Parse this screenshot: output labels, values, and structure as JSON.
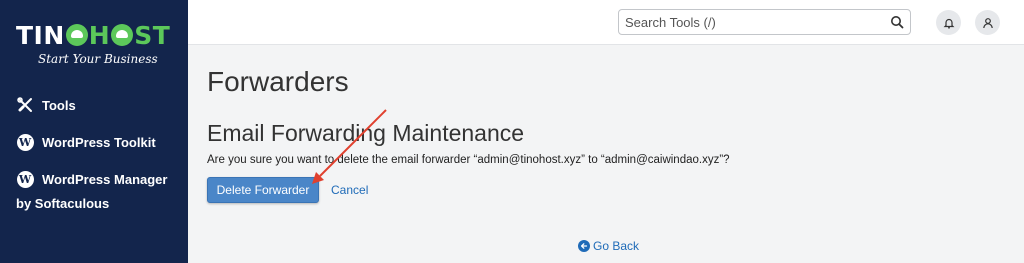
{
  "brand": {
    "name_part1": "TIN",
    "name_part2": "H",
    "name_part3": "ST",
    "tagline": "Start Your Business",
    "host_color": "#5cc85a",
    "sidebar_bg": "#13254c"
  },
  "sidebar": {
    "items": [
      {
        "label": "Tools",
        "icon": "tools-icon"
      },
      {
        "label": "WordPress Toolkit",
        "icon": "wordpress-icon"
      },
      {
        "label": "WordPress Manager",
        "icon": "wordpress-icon"
      }
    ],
    "manager_sub": "by Softaculous"
  },
  "header": {
    "search_placeholder": "Search Tools (/)",
    "notifications_icon": "bell-icon",
    "user_icon": "user-icon"
  },
  "main": {
    "page_title": "Forwarders",
    "section_title": "Email Forwarding Maintenance",
    "confirm_text": "Are you sure you want to delete the email forwarder “admin@tinohost.xyz” to “admin@caiwindao.xyz”?",
    "delete_label": "Delete Forwarder",
    "cancel_label": "Cancel",
    "go_back_label": "Go Back"
  },
  "colors": {
    "accent": "#4a86c8",
    "link": "#1f6bb8",
    "annotation_arrow": "#e0412f"
  }
}
